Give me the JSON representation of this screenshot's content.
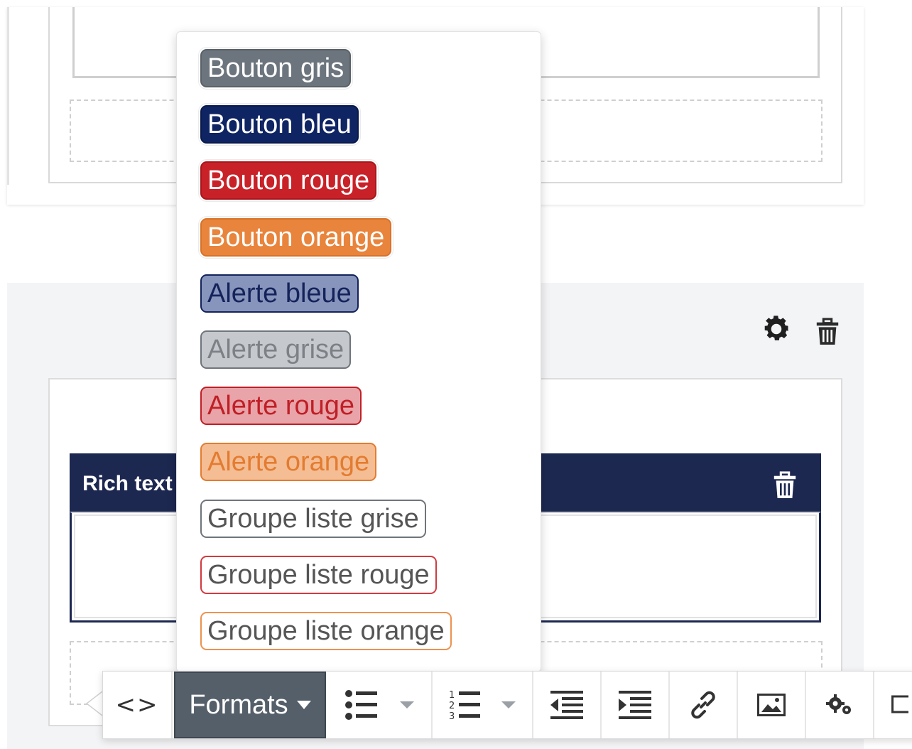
{
  "formats_menu": {
    "items": [
      {
        "label": "Bouton gris",
        "bg": "#6c757d",
        "fg": "#ffffff",
        "border": "#5a6268"
      },
      {
        "label": "Bouton bleu",
        "bg": "#0f2462",
        "fg": "#ffffff",
        "border": "#0a1a4a"
      },
      {
        "label": "Bouton rouge",
        "bg": "#c82128",
        "fg": "#ffffff",
        "border": "#a8171d"
      },
      {
        "label": "Bouton orange",
        "bg": "#e8843c",
        "fg": "#ffffff",
        "border": "#d8722a"
      },
      {
        "label": "Alerte bleue",
        "bg": "#8795bd",
        "fg": "#14235a",
        "border": "#14235a"
      },
      {
        "label": "Alerte grise",
        "bg": "#c5c8cc",
        "fg": "#7d8187",
        "border": "#6f757c"
      },
      {
        "label": "Alerte rouge",
        "bg": "#e8a4a8",
        "fg": "#c01f27",
        "border": "#c01f27"
      },
      {
        "label": "Alerte orange",
        "bg": "#f4bd94",
        "fg": "#e37c30",
        "border": "#e37c30"
      },
      {
        "label": "Groupe liste grise",
        "bg": "#ffffff",
        "fg": "#555555",
        "border": "#6f757c"
      },
      {
        "label": "Groupe liste rouge",
        "bg": "#ffffff",
        "fg": "#555555",
        "border": "#d13a40"
      },
      {
        "label": "Groupe liste orange",
        "bg": "#ffffff",
        "fg": "#555555",
        "border": "#ec924f"
      }
    ]
  },
  "rich_text_block": {
    "title": "Rich text"
  },
  "toolbar": {
    "source_label": "<>",
    "formats_label": "Formats"
  },
  "colors": {
    "header_navy": "#1d2851",
    "formats_button_bg": "#555f69",
    "icon_dark": "#333333"
  }
}
